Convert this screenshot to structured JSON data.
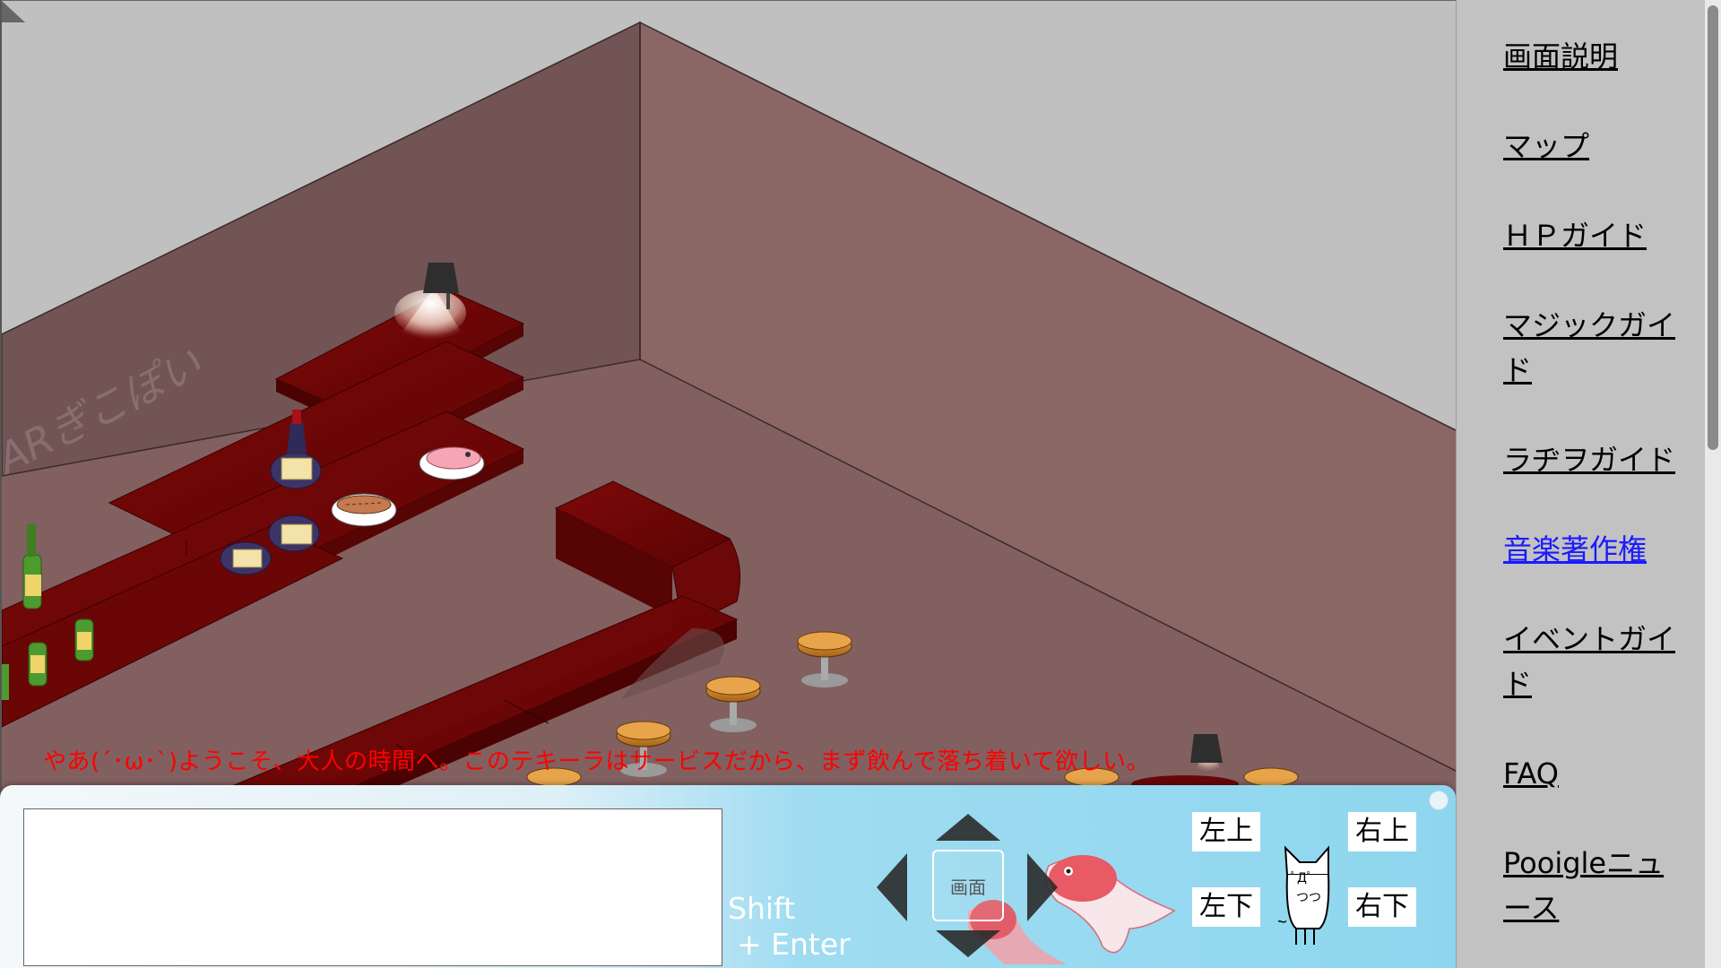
{
  "scene": {
    "watermark": "ARぎこぽい",
    "announcement": "やあ(´･ω･`)ようこそ、大人の時間へ。このテキーラはサービスだから、まず飲んで落ち着いて欲しい。"
  },
  "control_bar": {
    "input_value": "",
    "shift_line1": "Shift",
    "shift_line2": "+ Enter",
    "screen_label": "画面",
    "up_left": "左上",
    "up_right": "右上",
    "down_left": "左下",
    "down_right": "右下"
  },
  "sidebar": {
    "items": [
      {
        "label": "画面説明"
      },
      {
        "label": "マップ"
      },
      {
        "label": "ＨＰガイド"
      },
      {
        "label": "マジックガイド"
      },
      {
        "label": "ラヂヲガイド"
      },
      {
        "label": "音楽著作権"
      },
      {
        "label": "イベントガイド"
      },
      {
        "label": "FAQ"
      },
      {
        "label": "Pooigleニュース"
      }
    ],
    "active_index": 5
  },
  "colors": {
    "announcement": "#ff0000",
    "active_link": "#1a1aff",
    "floor": "#826060",
    "wall_left": "#725454",
    "wall_right": "#8a6664",
    "counter": "#6a0606"
  }
}
